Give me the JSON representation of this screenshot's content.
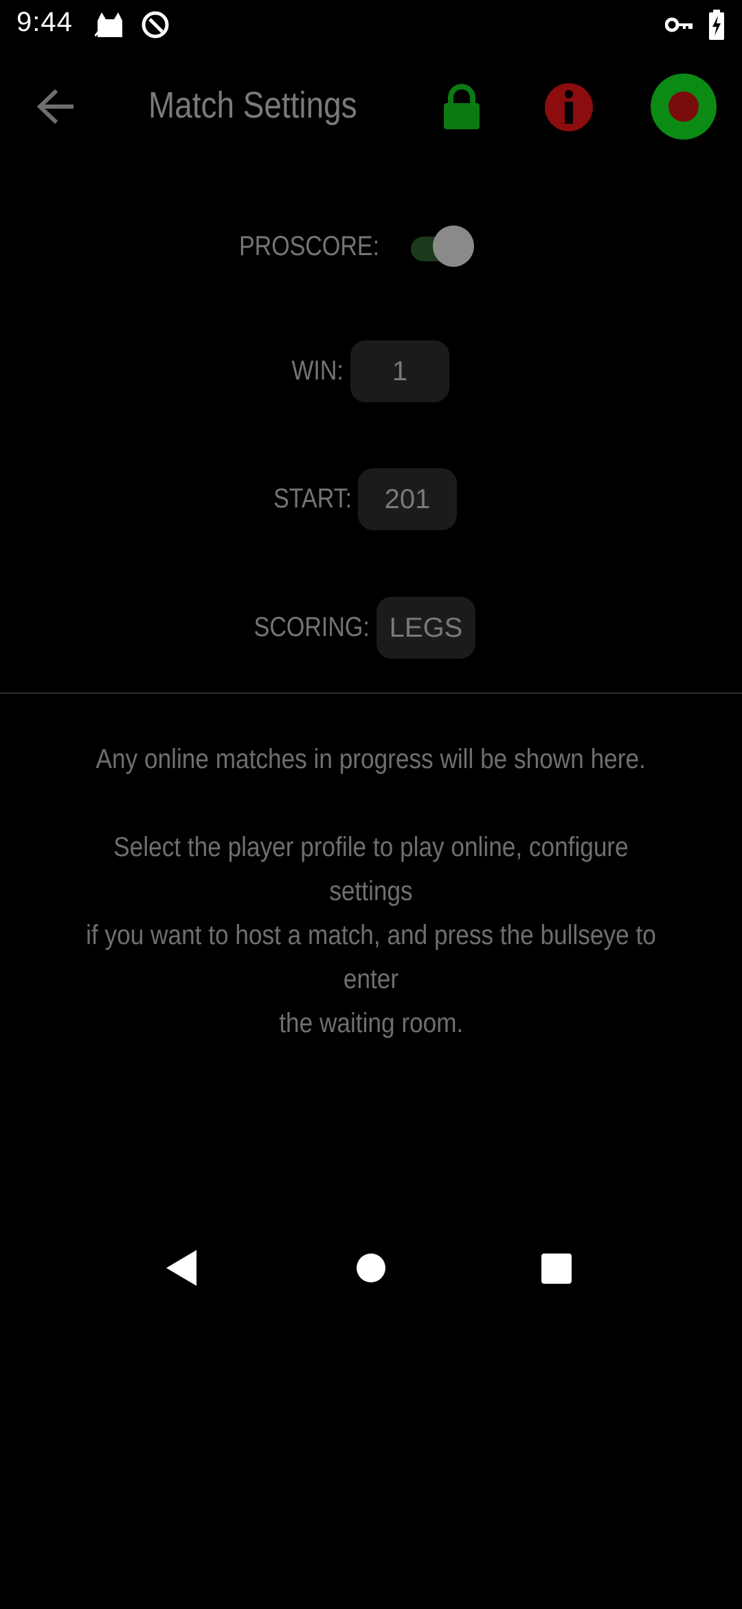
{
  "status_bar": {
    "time": "9:44",
    "left_icons": [
      "cat-icon",
      "q-circle-icon"
    ],
    "right_icons": [
      "key-icon",
      "battery-charging-icon"
    ]
  },
  "app_bar": {
    "back_icon": "arrow-left-icon",
    "title": "Match Settings",
    "lock_icon": "lock-icon",
    "info_icon": "info-icon",
    "bullseye_icon": "bullseye-icon"
  },
  "settings": {
    "proscore": {
      "label": "PROSCORE:",
      "enabled": true
    },
    "win": {
      "label": "WIN:",
      "value": "1"
    },
    "start": {
      "label": "START:",
      "value": "201"
    },
    "scoring": {
      "label": "SCORING:",
      "value": "LEGS"
    }
  },
  "info": {
    "line1": "Any online matches in progress will be shown here.",
    "line2a": "Select the player profile to play online, configure settings",
    "line2b": "if you want to host a match, and press the bullseye to enter",
    "line2c": "the waiting room."
  },
  "nav": {
    "back_icon": "triangle-back-icon",
    "home_icon": "circle-home-icon",
    "recents_icon": "square-recents-icon"
  },
  "colors": {
    "background": "#000000",
    "lock_green": "#0b7a12",
    "info_red": "#8b0d0d",
    "bullseye_outer": "#0b8a14",
    "bullseye_inner": "#7a0c0c",
    "toggle_track": "#1b3a1b",
    "toggle_thumb": "#8a8a8a",
    "box_bg": "#1b1b1b"
  }
}
